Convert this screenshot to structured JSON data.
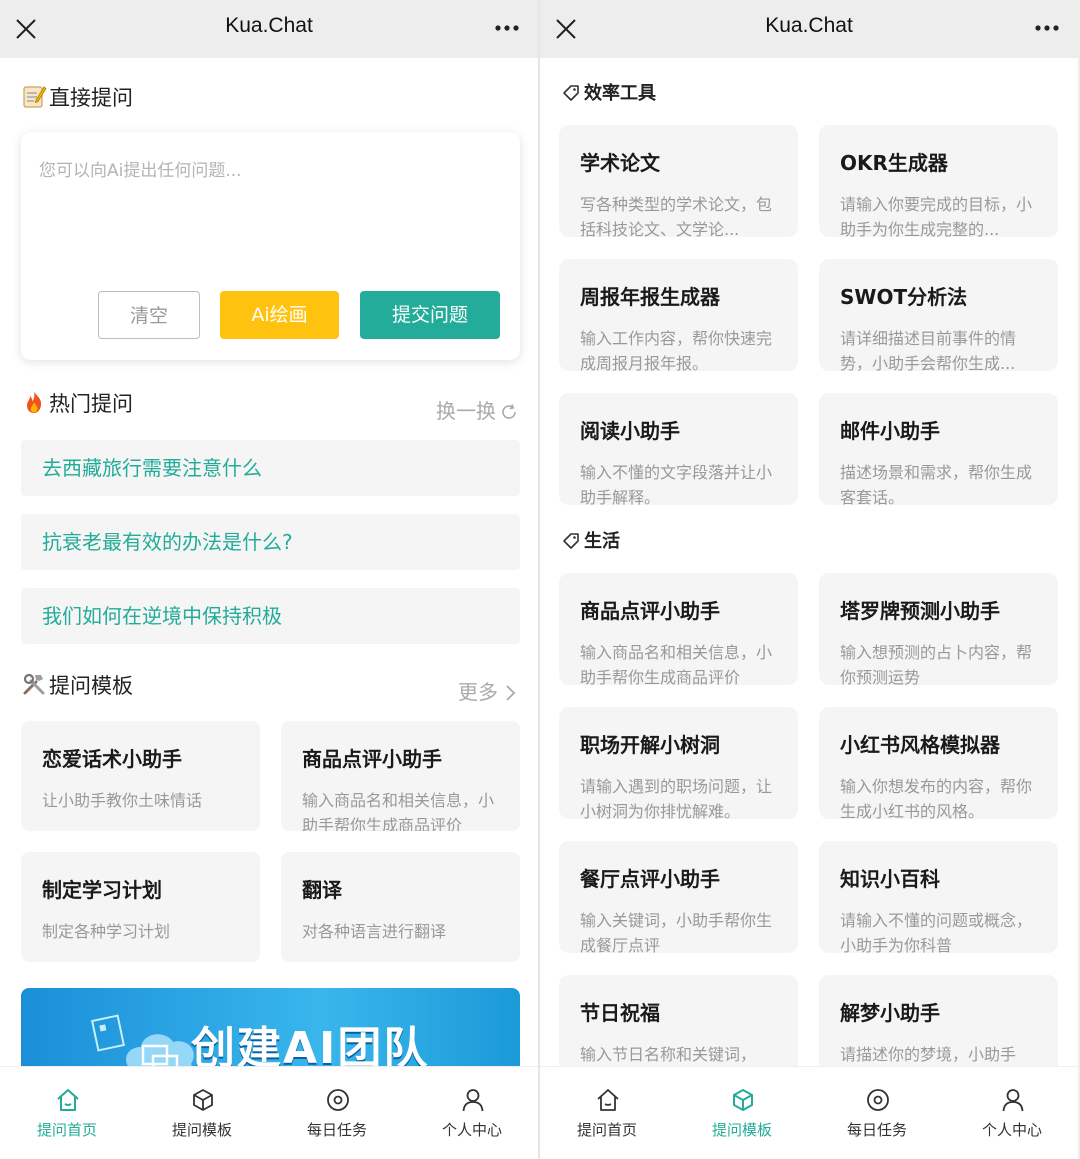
{
  "left": {
    "topbar": {
      "title": "Kua.Chat"
    },
    "direct_ask": {
      "title": "直接提问",
      "placeholder": "您可以向Ai提出任何问题...",
      "clear": "清空",
      "draw": "Ai绘画",
      "submit": "提交问题"
    },
    "hot": {
      "title": "热门提问",
      "refresh": "换一换",
      "items": [
        "去西藏旅行需要注意什么",
        "抗衰老最有效的办法是什么?",
        "我们如何在逆境中保持积极"
      ]
    },
    "templates": {
      "title": "提问模板",
      "more": "更多",
      "cards": [
        {
          "title": "恋爱话术小助手",
          "desc": "让小助手教你土味情话"
        },
        {
          "title": "商品点评小助手",
          "desc": "输入商品名和相关信息，小助手帮你生成商品评价"
        },
        {
          "title": "制定学习计划",
          "desc": "制定各种学习计划"
        },
        {
          "title": "翻译",
          "desc": "对各种语言进行翻译"
        }
      ]
    },
    "banner": {
      "text": "创建AI团队"
    },
    "tabs": [
      "提问首页",
      "提问模板",
      "每日任务",
      "个人中心"
    ],
    "active_tab": 0
  },
  "right": {
    "topbar": {
      "title": "Kua.Chat"
    },
    "categories": [
      {
        "name": "效率工具",
        "cards": [
          {
            "title": "学术论文",
            "desc": "写各种类型的学术论文，包括科技论文、文学论..."
          },
          {
            "title": "OKR生成器",
            "desc": "请输入你要完成的目标，小助手为你生成完整的..."
          },
          {
            "title": "周报年报生成器",
            "desc": "输入工作内容，帮你快速完成周报月报年报。"
          },
          {
            "title": "SWOT分析法",
            "desc": "请详细描述目前事件的情势，小助手会帮你生成..."
          },
          {
            "title": "阅读小助手",
            "desc": "输入不懂的文字段落并让小助手解释。"
          },
          {
            "title": "邮件小助手",
            "desc": "描述场景和需求，帮你生成客套话。"
          }
        ]
      },
      {
        "name": "生活",
        "cards": [
          {
            "title": "商品点评小助手",
            "desc": "输入商品名和相关信息，小助手帮你生成商品评价"
          },
          {
            "title": "塔罗牌预测小助手",
            "desc": "输入想预测的占卜内容，帮你预测运势"
          },
          {
            "title": "职场开解小树洞",
            "desc": "请输入遇到的职场问题，让小树洞为你排忧解难。"
          },
          {
            "title": "小红书风格模拟器",
            "desc": "输入你想发布的内容，帮你生成小红书的风格。"
          },
          {
            "title": "餐厅点评小助手",
            "desc": "输入关键词，小助手帮你生成餐厅点评"
          },
          {
            "title": "知识小百科",
            "desc": "请输入不懂的问题或概念，小助手为你科普"
          },
          {
            "title": "节日祝福",
            "desc": "输入节日名称和关键词，"
          },
          {
            "title": "解梦小助手",
            "desc": "请描述你的梦境，小助手"
          }
        ]
      }
    ],
    "tabs": [
      "提问首页",
      "提问模板",
      "每日任务",
      "个人中心"
    ],
    "active_tab": 1
  },
  "colors": {
    "accent": "#22ac99",
    "yellow": "#ffc20e",
    "card_bg": "#f5f5f5"
  },
  "icons": [
    "close-icon",
    "more-icon",
    "memo-icon",
    "fire-icon",
    "tools-icon",
    "refresh-icon",
    "chevron-right-icon",
    "tag-icon",
    "home-icon",
    "cube-icon",
    "target-icon",
    "user-icon"
  ]
}
